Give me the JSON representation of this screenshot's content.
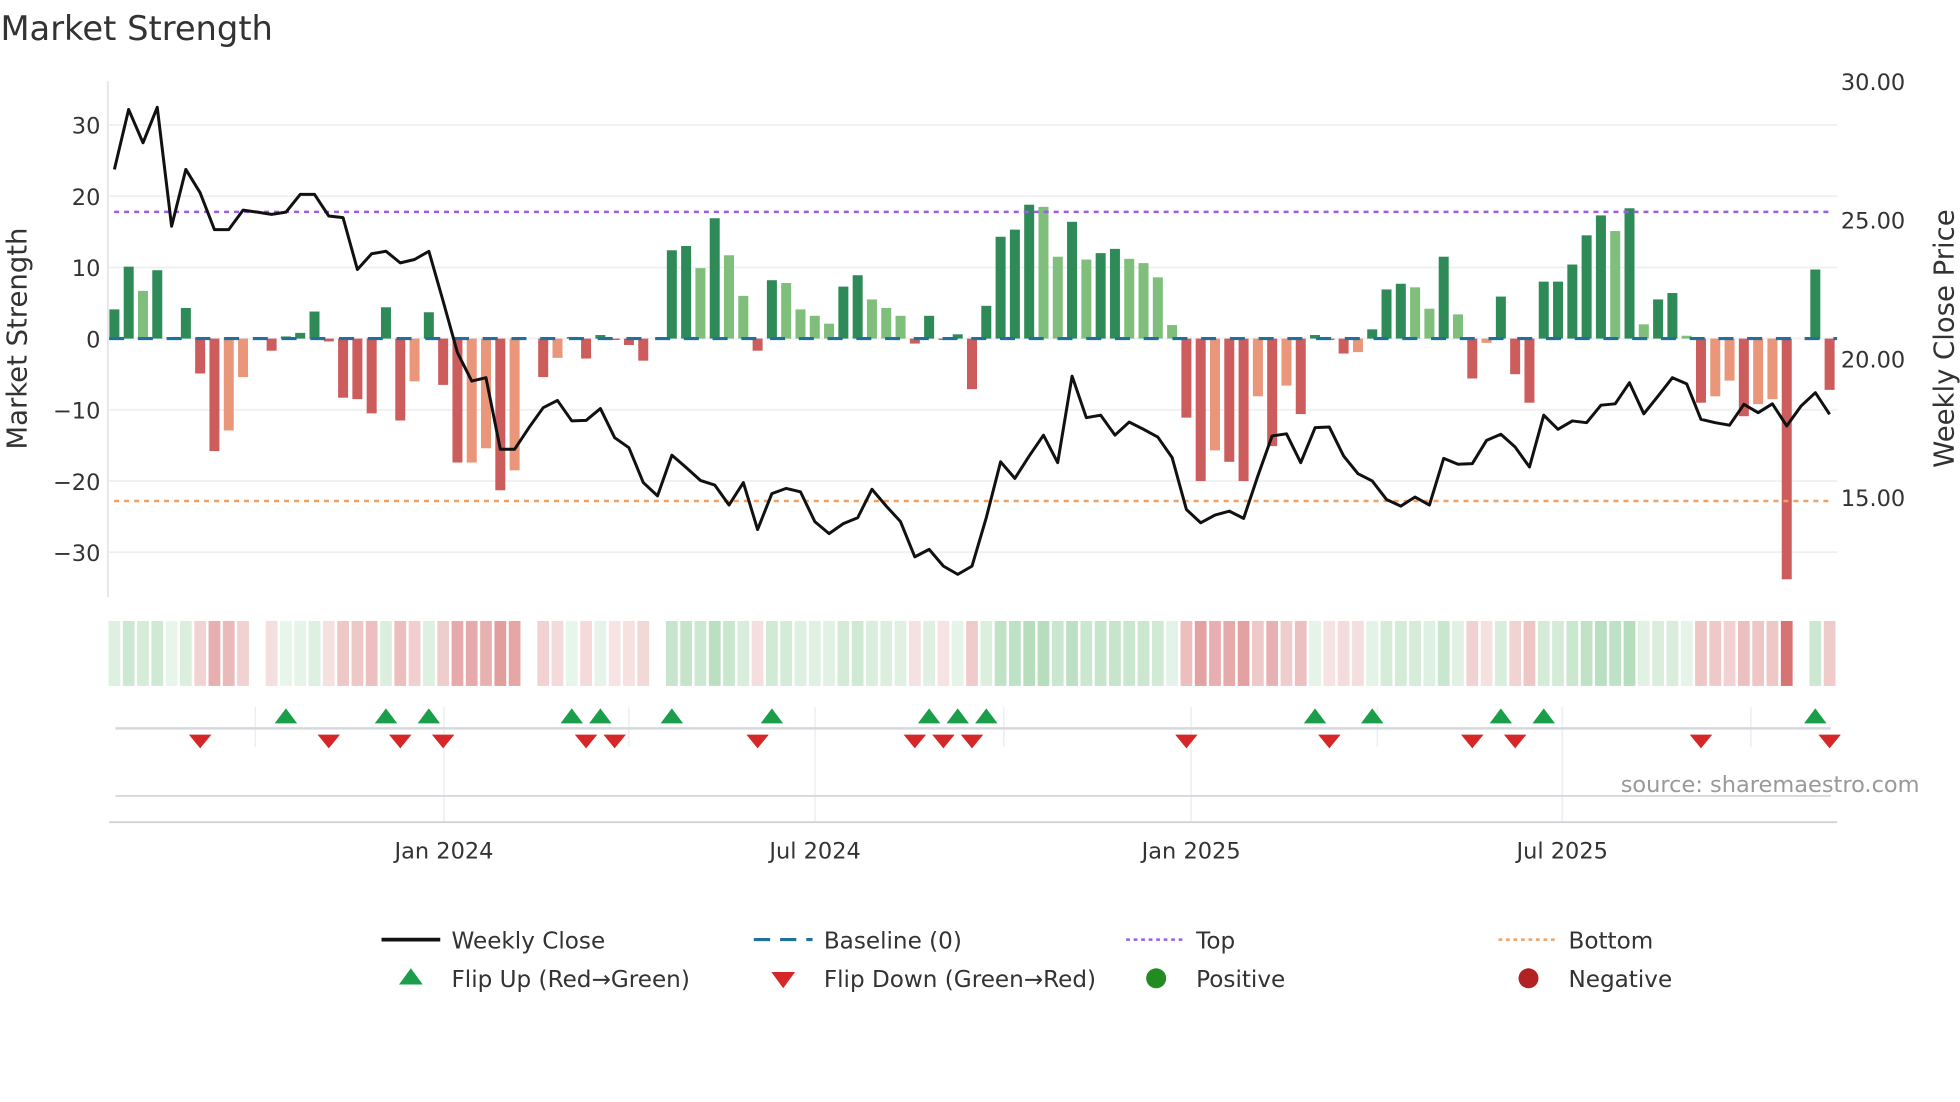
{
  "chart_data": {
    "type": "bar",
    "title": "Market Strength",
    "ylabel": "Market Strength",
    "y2label": "Weekly Close Price",
    "ylim": [
      -36,
      36
    ],
    "y2lim": [
      11.6,
      30
    ],
    "y_ticks": [
      "30",
      "20",
      "10",
      "0",
      "−10",
      "−20",
      "−30"
    ],
    "y2_ticks": [
      "30.00",
      "25.00",
      "20.00",
      "15.00"
    ],
    "x_ticks": [
      "Jan 2024",
      "Jul 2024",
      "Jan 2025",
      "Jul 2025"
    ],
    "grid": true,
    "legend_placement": "bottom",
    "top_level": 17.8,
    "bottom_level": -22.8,
    "baseline": 0,
    "series": [
      {
        "name": "Market Strength",
        "type": "bar",
        "values": [
          4.1,
          10.1,
          6.7,
          9.6,
          0.2,
          4.3,
          -4.9,
          -15.8,
          -12.9,
          -5.4,
          0,
          -1.7,
          0.3,
          0.8,
          3.8,
          -0.4,
          -8.3,
          -8.5,
          -10.5,
          4.4,
          -11.5,
          -6.0,
          3.7,
          -6.5,
          -17.4,
          -17.4,
          -15.4,
          -21.3,
          -18.5,
          0,
          -5.4,
          -2.7,
          0.2,
          -2.8,
          0.5,
          -0.2,
          -0.9,
          -3.1,
          0,
          12.4,
          13.0,
          9.9,
          16.9,
          11.7,
          6.0,
          -1.7,
          8.2,
          7.8,
          4.1,
          3.2,
          2.1,
          7.3,
          8.9,
          5.5,
          4.3,
          3.2,
          -0.7,
          3.2,
          -0.2,
          0.6,
          -7.1,
          4.6,
          14.3,
          15.3,
          18.8,
          18.5,
          11.5,
          16.4,
          11.1,
          12.0,
          12.6,
          11.2,
          10.6,
          8.6,
          1.9,
          -11.1,
          -20.0,
          -15.7,
          -17.3,
          -20.0,
          -8.1,
          -15.1,
          -6.6,
          -10.6,
          0.5,
          -0.2,
          -2.1,
          -1.9,
          1.3,
          6.9,
          7.7,
          7.2,
          4.2,
          11.5,
          3.4,
          -5.6,
          -0.6,
          5.9,
          -5.0,
          -9.0,
          8.0,
          8.0,
          10.4,
          14.5,
          17.3,
          15.1,
          18.3,
          2.0,
          5.5,
          6.4,
          0.4,
          -9.0,
          -8.1,
          -5.9,
          -10.9,
          -9.2,
          -8.5,
          -33.8,
          0,
          9.7,
          -7.2
        ]
      },
      {
        "name": "Weekly Close",
        "type": "line",
        "axis": "right",
        "values": [
          26.82,
          28.98,
          27.78,
          29.06,
          24.77,
          26.82,
          25.98,
          24.65,
          24.65,
          25.35,
          25.28,
          25.2,
          25.28,
          25.92,
          25.92,
          25.14,
          25.08,
          23.21,
          23.78,
          23.87,
          23.45,
          23.57,
          23.87,
          22.07,
          20.21,
          19.19,
          19.31,
          16.73,
          16.73,
          17.51,
          18.23,
          18.49,
          17.75,
          17.77,
          18.2,
          17.15,
          16.79,
          15.53,
          15.05,
          16.52,
          16.07,
          15.61,
          15.44,
          14.72,
          15.53,
          13.84,
          15.13,
          15.32,
          15.2,
          14.12,
          13.69,
          14.05,
          14.26,
          15.29,
          14.68,
          14.12,
          12.85,
          13.12,
          12.52,
          12.22,
          12.52,
          14.26,
          16.28,
          15.68,
          16.49,
          17.24,
          16.25,
          19.37,
          17.87,
          17.96,
          17.24,
          17.71,
          17.45,
          17.17,
          16.43,
          14.56,
          14.08,
          14.36,
          14.5,
          14.24,
          15.77,
          17.21,
          17.29,
          16.25,
          17.51,
          17.53,
          16.49,
          15.85,
          15.59,
          14.92,
          14.68,
          15.01,
          14.72,
          16.4,
          16.19,
          16.21,
          17.05,
          17.27,
          16.81,
          16.09,
          17.96,
          17.45,
          17.75,
          17.69,
          18.32,
          18.37,
          19.13,
          18.01,
          18.65,
          19.31,
          19.09,
          17.81,
          17.69,
          17.6,
          18.35,
          18.05,
          18.37,
          17.57,
          18.29,
          18.77,
          17.99
        ]
      }
    ],
    "colors": {
      "rising_positive": "#2e8b57",
      "falling_positive": "#7fbf7b",
      "falling_negative": "#cd5c5c",
      "recovering_negative": "#e9967a",
      "close_line": "#111111",
      "baseline": "#1f6f9f",
      "top": "#9b5de5",
      "bottom": "#f0a060",
      "flip_up": "#1a9e4a",
      "flip_down": "#d62728",
      "positive": "#228b22",
      "negative": "#b22222"
    },
    "legend": [
      {
        "label": "Weekly Close",
        "symbol": "line"
      },
      {
        "label": "Baseline (0)",
        "symbol": "dashed-line"
      },
      {
        "label": "Top",
        "symbol": "dotted-line"
      },
      {
        "label": "Bottom",
        "symbol": "dotted-line"
      },
      {
        "label": "Flip Up (Red→Green)",
        "symbol": "triangle-up"
      },
      {
        "label": "Flip Down (Green→Red)",
        "symbol": "triangle-down"
      },
      {
        "label": "Positive",
        "symbol": "circle"
      },
      {
        "label": "Negative",
        "symbol": "circle"
      }
    ]
  },
  "source": "source: sharemaestro.com"
}
